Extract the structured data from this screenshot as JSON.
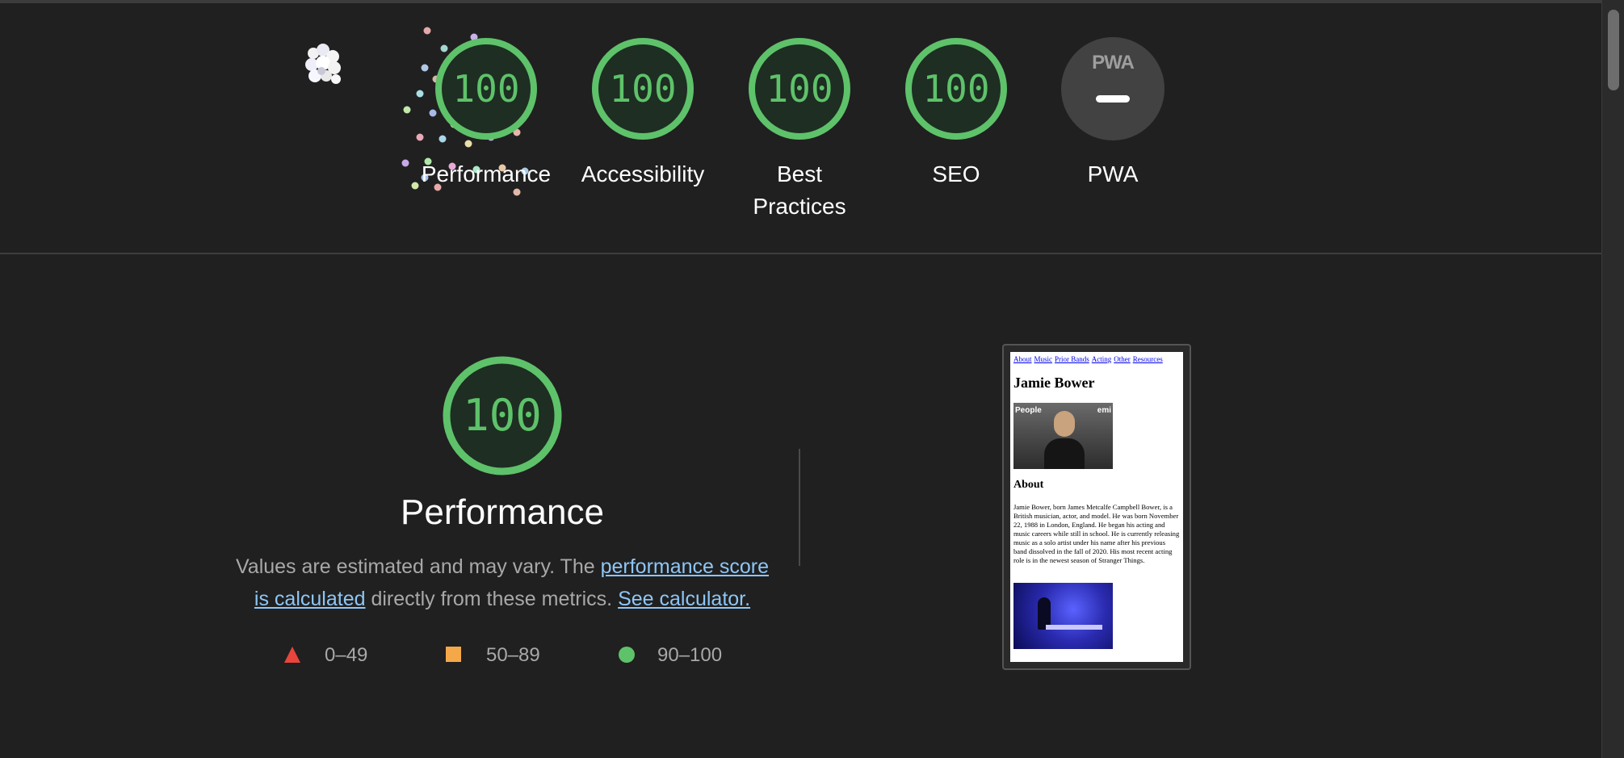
{
  "header": {
    "gauges": [
      {
        "label": "Performance",
        "score": "100"
      },
      {
        "label": "Accessibility",
        "score": "100"
      },
      {
        "label": "Best Practices",
        "score": "100"
      },
      {
        "label": "SEO",
        "score": "100"
      }
    ],
    "pwa": {
      "label": "PWA",
      "badge_text": "PWA"
    }
  },
  "main": {
    "score": "100",
    "title": "Performance",
    "desc_prefix": "Values are estimated and may vary. The ",
    "desc_link1": "performance score is calculated",
    "desc_middle": " directly from these metrics. ",
    "desc_link2": "See calculator.",
    "legend": [
      {
        "shape": "triangle",
        "range": "0–49",
        "color": "#e8453c"
      },
      {
        "shape": "square",
        "range": "50–89",
        "color": "#f5a84a"
      },
      {
        "shape": "circle",
        "range": "90–100",
        "color": "#5ec26a"
      }
    ]
  },
  "thumbnail": {
    "nav": [
      "About",
      "Music",
      "Prior Bands",
      "Acting",
      "Other",
      "Resources"
    ],
    "heading": "Jamie Bower",
    "img_brand": "People",
    "img_brand2": "emi",
    "about_heading": "About",
    "about_text": "Jamie Bower, born James Metcalfe Campbell Bower, is a British musician, actor, and model. He was born November 22, 1988 in London, England. He began his acting and music careers while still in school. He is currently releasing music as a solo artist under his name after his previous band dissolved in the fall of 2020. His most recent acting role is in the newest season of Stranger Things."
  },
  "colors": {
    "pass": "#5ec26a",
    "average": "#f5a84a",
    "fail": "#e8453c",
    "link": "#8ec6f5",
    "background": "#202020"
  }
}
